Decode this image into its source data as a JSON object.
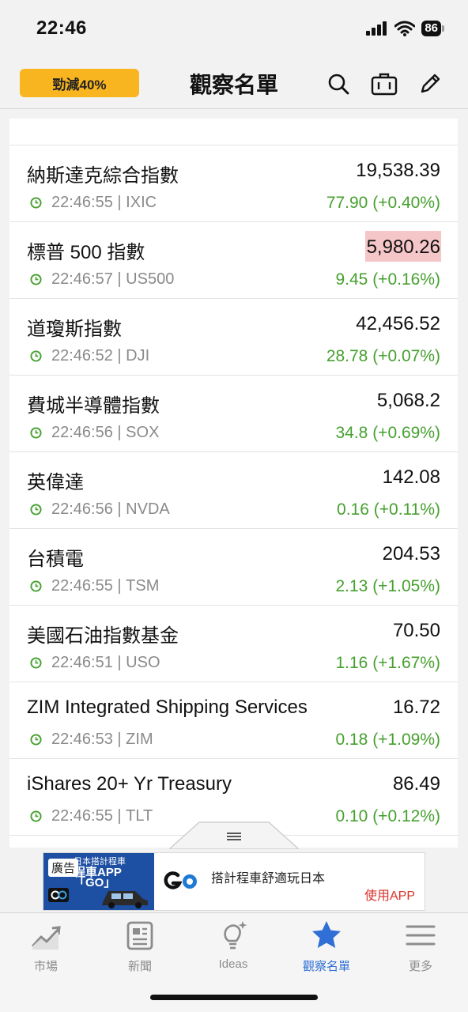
{
  "status": {
    "time": "22:46",
    "battery": "86"
  },
  "header": {
    "promo": "勁減40%",
    "title": "觀察名單",
    "icons": [
      "search-icon",
      "briefcase-icon",
      "edit-icon"
    ]
  },
  "watchlist": [
    {
      "name": "納斯達克綜合指數",
      "time": "22:46:55",
      "symbol": "IXIC",
      "price": "19,538.39",
      "change": "77.90 (+0.40%)"
    },
    {
      "name": "標普 500 指數",
      "time": "22:46:57",
      "symbol": "US500",
      "price": "5,980.26",
      "change": "9.45 (+0.16%)"
    },
    {
      "name": "道瓊斯指數",
      "time": "22:46:52",
      "symbol": "DJI",
      "price": "42,456.52",
      "change": "28.78 (+0.07%)"
    },
    {
      "name": "費城半導體指數",
      "time": "22:46:56",
      "symbol": "SOX",
      "price": "5,068.2",
      "change": "34.8 (+0.69%)"
    },
    {
      "name": "英偉達",
      "time": "22:46:56",
      "symbol": "NVDA",
      "price": "142.08",
      "change": "0.16 (+0.11%)"
    },
    {
      "name": "台積電",
      "time": "22:46:55",
      "symbol": "TSM",
      "price": "204.53",
      "change": "2.13 (+1.05%)"
    },
    {
      "name": "美國石油指數基金",
      "time": "22:46:51",
      "symbol": "USO",
      "price": "70.50",
      "change": "1.16 (+1.67%)"
    },
    {
      "name": "ZIM Integrated Shipping Services",
      "time": "22:46:53",
      "symbol": "ZIM",
      "price": "16.72",
      "change": "0.18 (+1.09%)"
    },
    {
      "name": "iShares 20+ Yr Treasury",
      "time": "22:46:55",
      "symbol": "TLT",
      "price": "86.49",
      "change": "0.10 (+0.12%)"
    }
  ],
  "ad": {
    "label": "廣告",
    "image_line1": "日本搭計程車",
    "image_line2": "程車APP「GO」",
    "text": "搭計程車舒適玩日本",
    "cta": "使用APP"
  },
  "tabs": [
    {
      "label": "市場",
      "icon": "chart-icon"
    },
    {
      "label": "新聞",
      "icon": "news-icon"
    },
    {
      "label": "Ideas",
      "icon": "lightbulb-icon"
    },
    {
      "label": "觀察名單",
      "icon": "star-icon"
    },
    {
      "label": "更多",
      "icon": "menu-icon"
    }
  ],
  "colors": {
    "up": "#46a02f",
    "accent": "#2f6fd6",
    "promo": "#f9b51f",
    "flash": "#f5c6c8"
  }
}
